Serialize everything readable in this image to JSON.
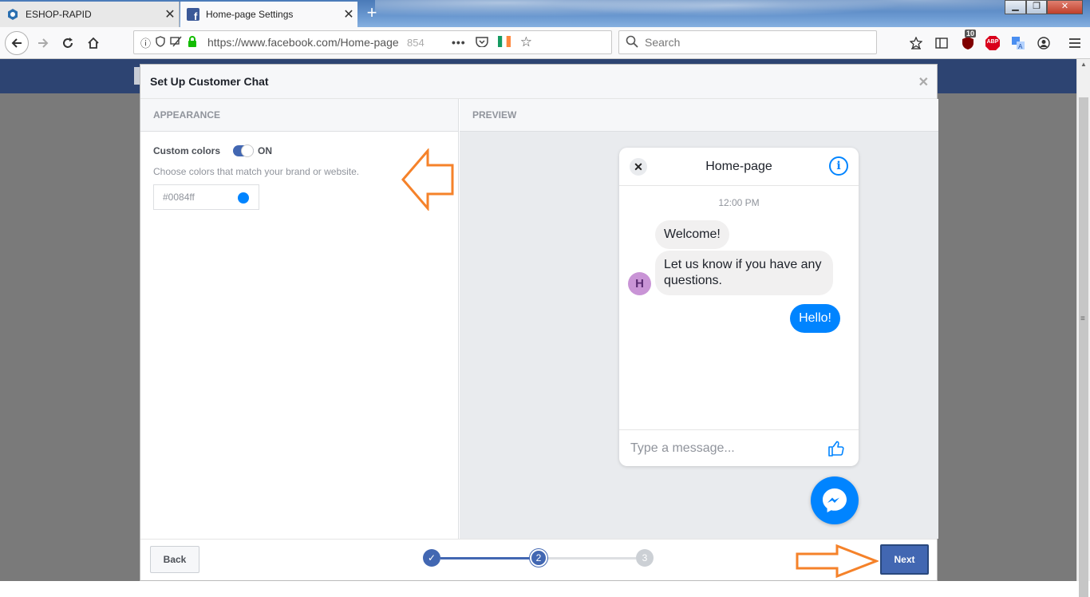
{
  "browser": {
    "tabs": [
      {
        "title": "ESHOP-RAPID",
        "active": false
      },
      {
        "title": "Home-page Settings",
        "active": true
      }
    ],
    "url": "https://www.facebook.com/Home-page",
    "zoom_hint": "854",
    "search_placeholder": "Search",
    "ublock_count": "10",
    "abp_label": "ABP"
  },
  "dialog": {
    "title": "Set Up Customer Chat",
    "appearance_header": "APPEARANCE",
    "preview_header": "PREVIEW",
    "custom_colors_label": "Custom colors",
    "toggle_state": "ON",
    "help_text": "Choose colors that match your brand or website.",
    "color_value": "#0084ff",
    "back_label": "Back",
    "next_label": "Next",
    "steps": [
      "✓",
      "2",
      "3"
    ]
  },
  "chat": {
    "page_name": "Home-page",
    "time": "12:00 PM",
    "avatar_letter": "H",
    "messages": [
      {
        "from": "page",
        "text": "Welcome!"
      },
      {
        "from": "page",
        "text": "Let us know if you have any questions."
      },
      {
        "from": "user",
        "text": "Hello!"
      }
    ],
    "input_placeholder": "Type a message..."
  },
  "colors": {
    "accent": "#0084ff",
    "fb_blue": "#4267b2",
    "annotation_orange": "#f5822a"
  }
}
